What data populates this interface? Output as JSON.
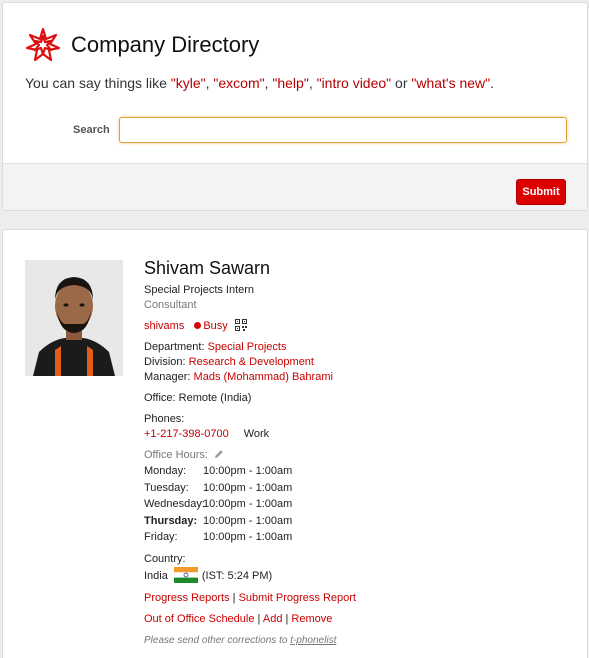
{
  "app": {
    "title": "Company Directory",
    "hint_prefix": "You can say things like ",
    "hint_parts": [
      {
        "text": "\"kyle\"",
        "kw": true
      },
      {
        "text": ", ",
        "kw": false
      },
      {
        "text": "\"excom\"",
        "kw": true
      },
      {
        "text": ", ",
        "kw": false
      },
      {
        "text": "\"help\"",
        "kw": true
      },
      {
        "text": ", ",
        "kw": false
      },
      {
        "text": "\"intro video\"",
        "kw": true
      },
      {
        "text": " or ",
        "kw": false
      },
      {
        "text": "\"what's new\"",
        "kw": true
      },
      {
        "text": ".",
        "kw": false
      }
    ]
  },
  "search": {
    "label": "Search",
    "value": "",
    "placeholder": ""
  },
  "submit_label": "Submit",
  "person": {
    "name": "Shivam Sawarn",
    "position": "Special Projects Intern",
    "role": "Consultant",
    "username": "shivams",
    "status": "Busy",
    "department_label": "Department:",
    "department": "Special Projects",
    "division_label": "Division:",
    "division": "Research & Development",
    "manager_label": "Manager:",
    "manager": "Mads (Mohammad) Bahrami",
    "office_label": "Office:",
    "office": "Remote (India)",
    "phones_label": "Phones:",
    "phone": "+1-217-398-0700",
    "phone_type": "Work",
    "hours_label": "Office Hours:",
    "hours": [
      {
        "day": "Monday:",
        "time": "10:00pm - 1:00am",
        "bold": false
      },
      {
        "day": "Tuesday:",
        "time": "10:00pm - 1:00am",
        "bold": false
      },
      {
        "day": "Wednesday:",
        "time": "10:00pm - 1:00am",
        "bold": false
      },
      {
        "day": "Thursday:",
        "time": "10:00pm - 1:00am",
        "bold": true
      },
      {
        "day": "Friday:",
        "time": "10:00pm - 1:00am",
        "bold": false
      }
    ],
    "country_label": "Country:",
    "country": "India",
    "local_time": "(IST: 5:24 PM)",
    "links": {
      "progress_reports": "Progress Reports",
      "submit_progress_report": "Submit Progress Report",
      "ooo_schedule": "Out of Office Schedule",
      "add": "Add",
      "remove": "Remove",
      "separator": " | "
    },
    "note_prefix": "Please send other corrections to ",
    "note_link": "t-phonelist"
  },
  "colors": {
    "accent": "#c80000",
    "submit_bg": "#dd0000",
    "status_busy": "#dd0000",
    "search_focus": "#e2a23a"
  },
  "icons": {
    "logo": "spikey-logo-icon",
    "status": "busy-dot-icon",
    "qr": "qr-code-icon",
    "edit": "pencil-icon",
    "flag": "india-flag-icon"
  }
}
